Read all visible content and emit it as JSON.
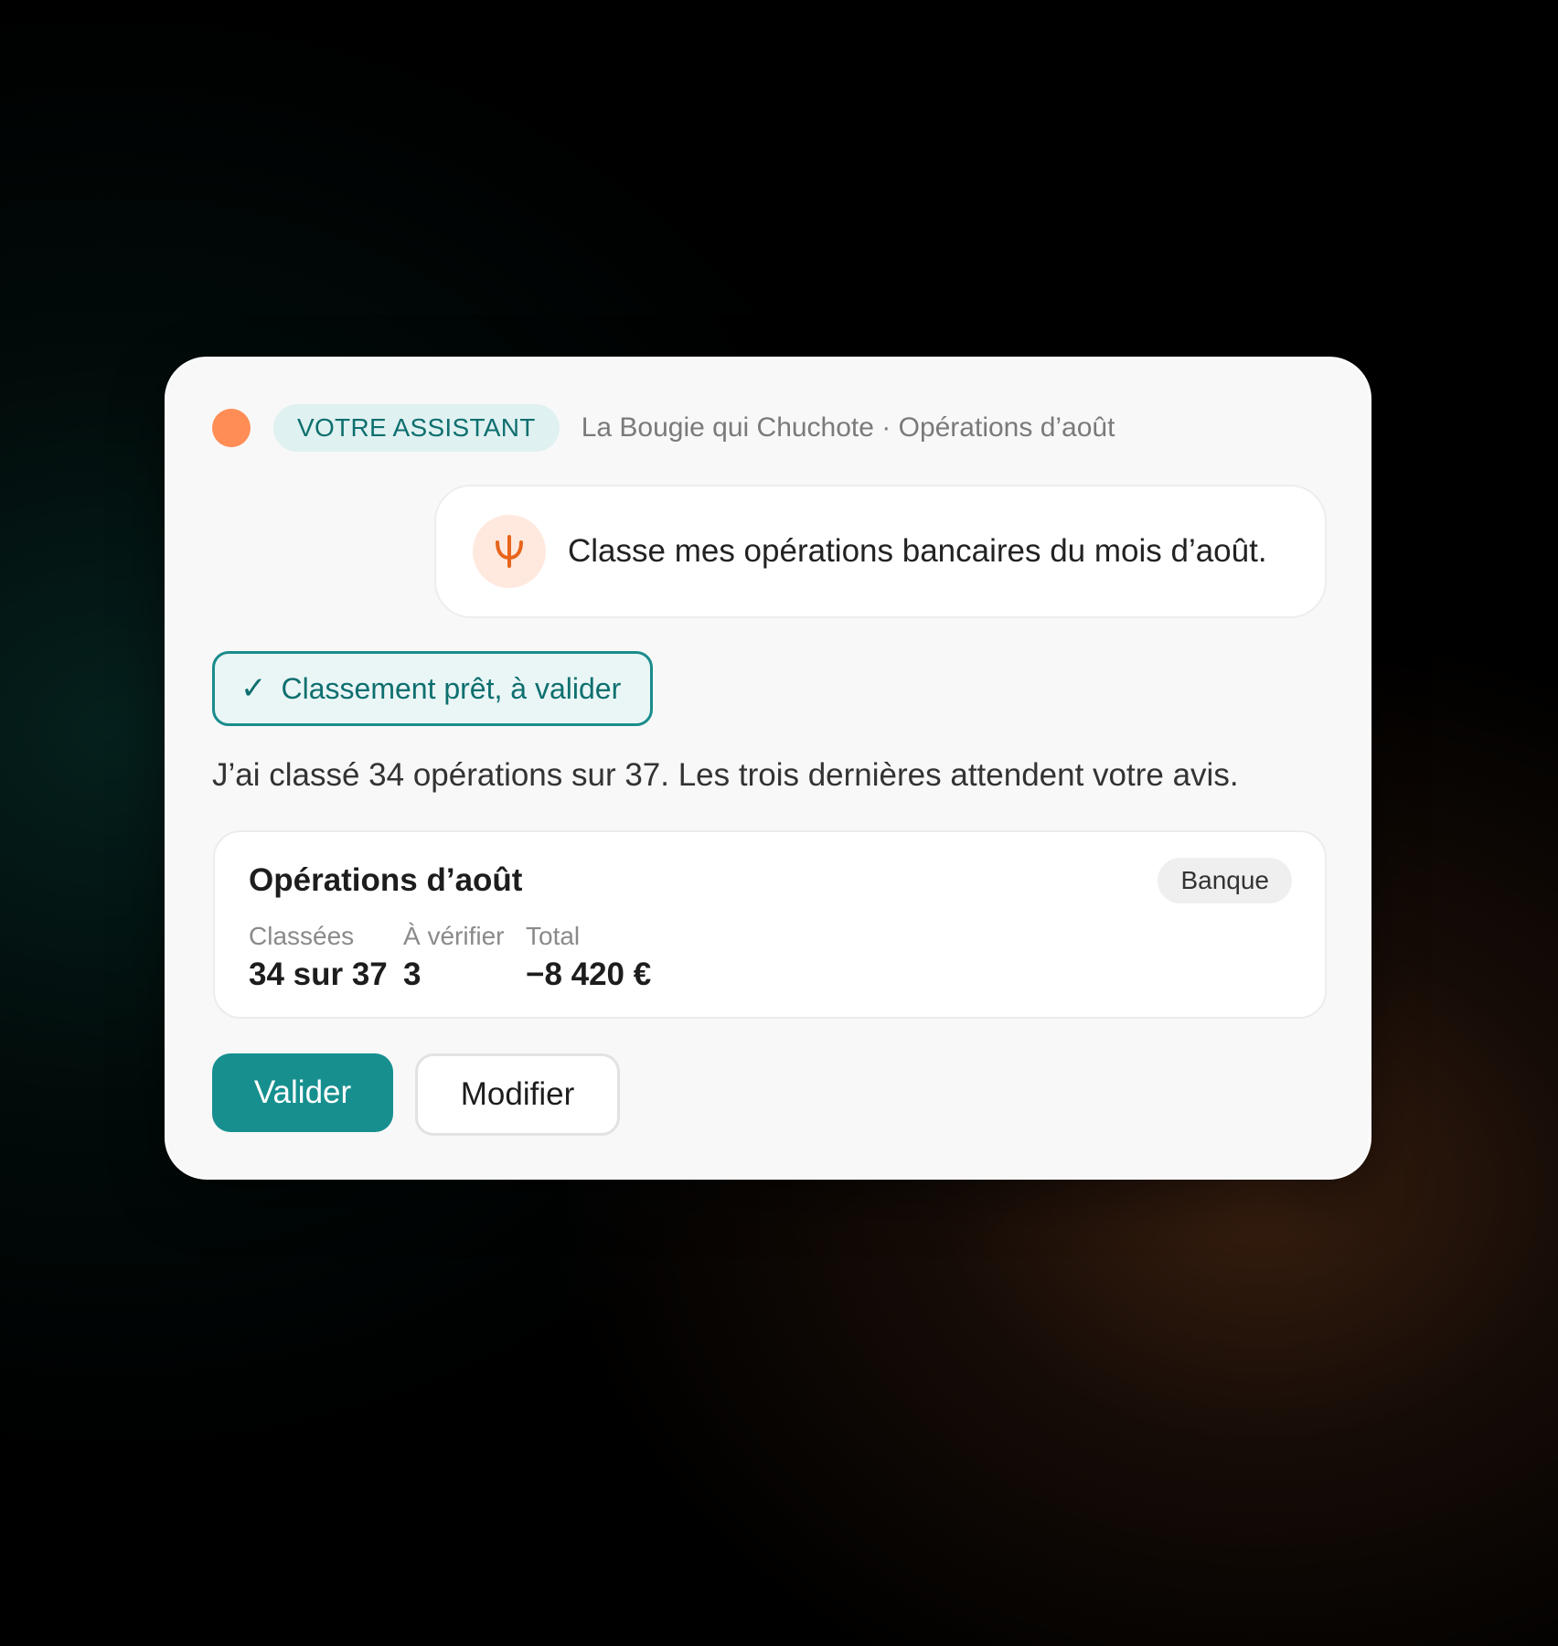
{
  "header": {
    "assistant_label": "VOTRE ASSISTANT",
    "context": "La Bougie qui Chuchote · Opérations d’août"
  },
  "user_message": {
    "icon": "microphone-icon",
    "text": "Classe mes opérations bancaires du mois d’août."
  },
  "status": {
    "icon": "✓",
    "text": "Classement prêt, à valider"
  },
  "reply": "J’ai classé 34 opérations sur 37. Les trois dernières attendent votre avis.",
  "summary": {
    "title": "Opérations d’août",
    "source": "Banque",
    "stats": [
      {
        "label": "Classées",
        "value": "34 sur 37"
      },
      {
        "label": "À vérifier",
        "value": "3"
      },
      {
        "label": "Total",
        "value": "−8 420 €"
      }
    ]
  },
  "actions": {
    "primary": "Valider",
    "secondary": "Modifier"
  },
  "colors": {
    "accent": "#178f8f",
    "status_dot": "#ff8d55",
    "mic": "#e8641b"
  }
}
